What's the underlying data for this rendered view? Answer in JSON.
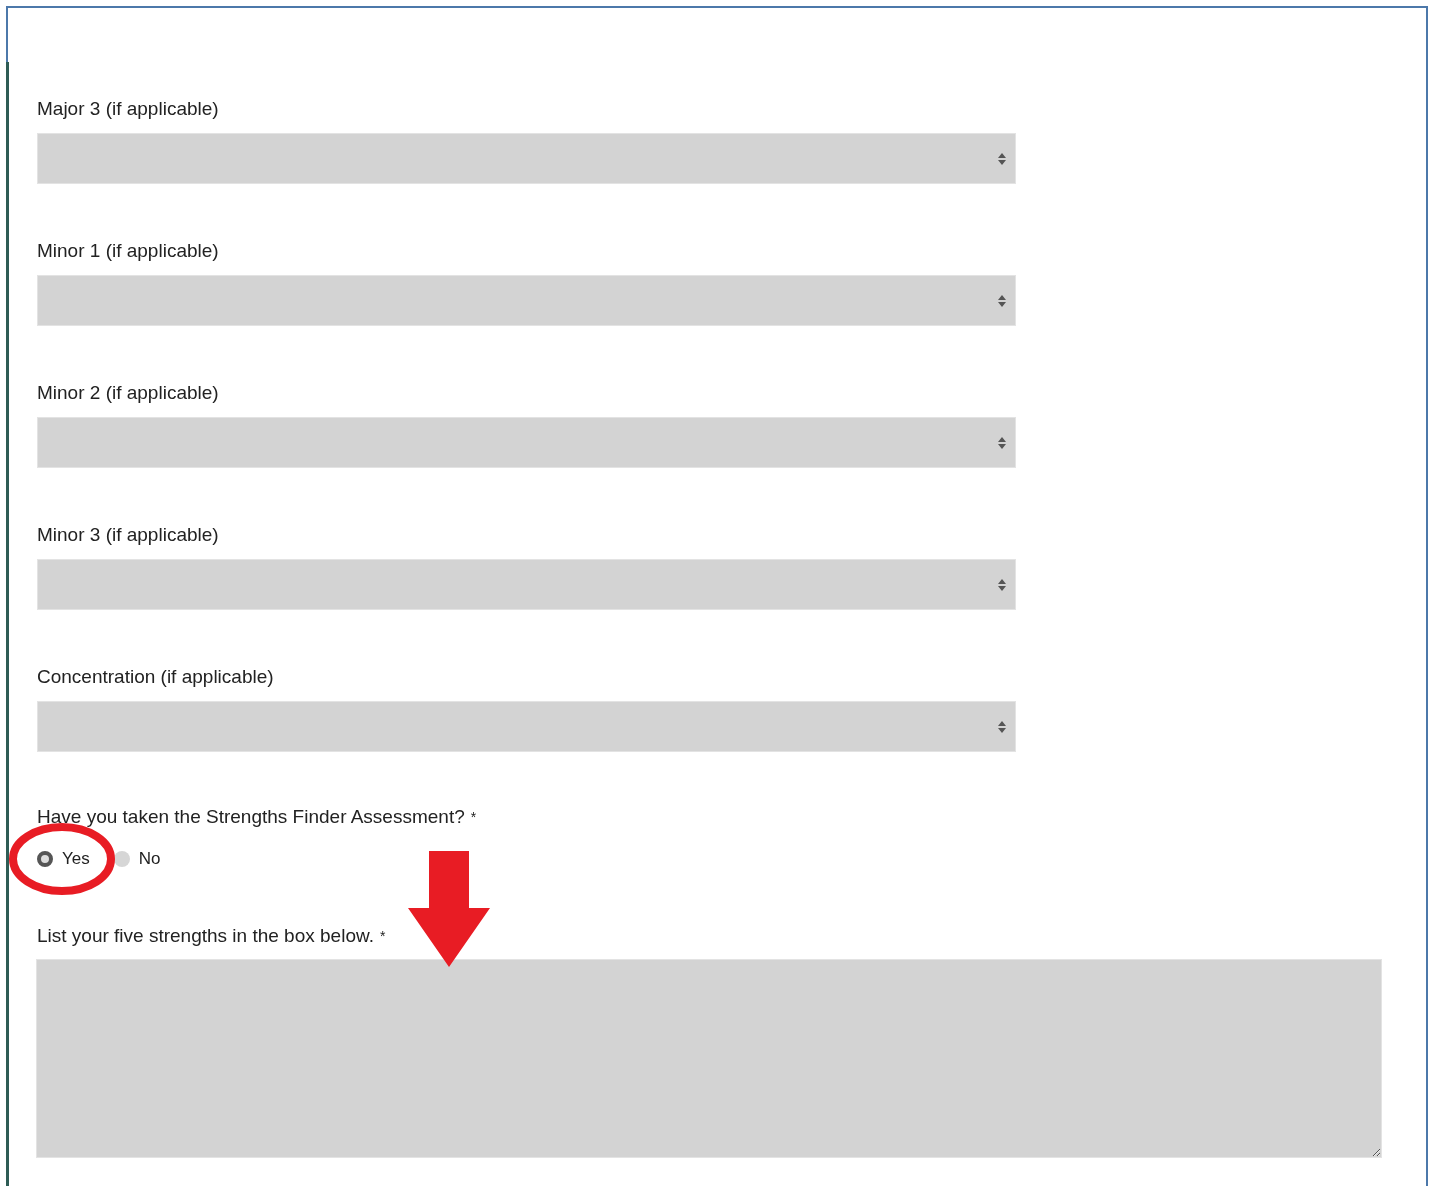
{
  "selects": [
    {
      "label": "Major 3 (if applicable)"
    },
    {
      "label": "Minor 1 (if applicable)"
    },
    {
      "label": "Minor 2 (if applicable)"
    },
    {
      "label": "Minor 3 (if applicable)"
    },
    {
      "label": "Concentration (if applicable)"
    }
  ],
  "question": {
    "label": "Have you taken the Strengths Finder Assessment?",
    "required": "*",
    "options": [
      {
        "label": "Yes",
        "selected": true
      },
      {
        "label": "No",
        "selected": false
      }
    ]
  },
  "strengths": {
    "label": "List your five strengths in the box below.",
    "required": "*"
  }
}
